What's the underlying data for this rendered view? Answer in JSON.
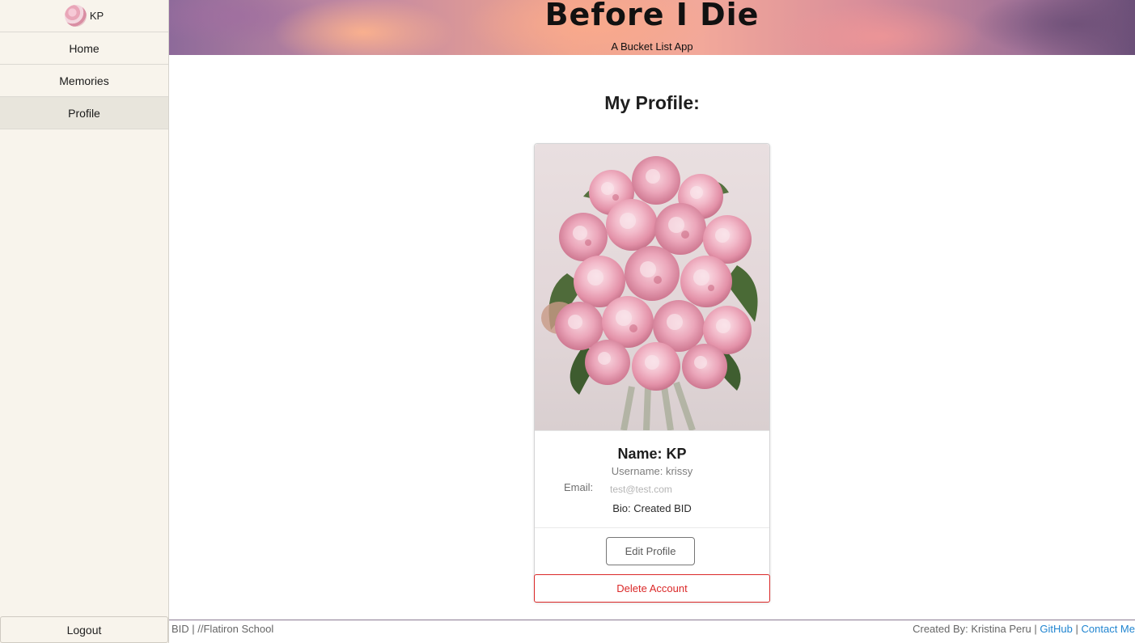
{
  "sidebar": {
    "user_initials": "KP",
    "items": [
      {
        "label": "Home"
      },
      {
        "label": "Memories"
      },
      {
        "label": "Profile",
        "active": true
      }
    ],
    "logout_label": "Logout"
  },
  "header": {
    "title": "Before I Die",
    "subtitle": "A Bucket List App"
  },
  "main": {
    "page_title": "My Profile:",
    "profile": {
      "name": "Name: KP",
      "username": "Username: krissy",
      "email_label": "Email:",
      "email_value": "test@test.com",
      "bio": "Bio: Created BID",
      "edit_label": "Edit Profile",
      "delete_label": "Delete Account"
    }
  },
  "footer": {
    "left_text": "BID | //Flatiron School",
    "credit_text": "Created By: Kristina Peru |",
    "github_label": "GitHub",
    "separator": "|",
    "contact_label": "Contact Me"
  },
  "colors": {
    "sidebar_bg": "#f8f4ec",
    "danger": "#db2828",
    "link": "#2185d0"
  }
}
